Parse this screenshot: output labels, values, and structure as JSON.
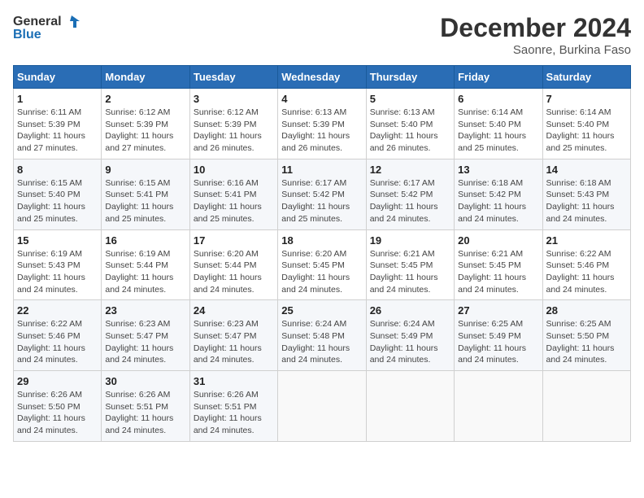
{
  "header": {
    "logo_line1": "General",
    "logo_line2": "Blue",
    "title": "December 2024",
    "subtitle": "Saonre, Burkina Faso"
  },
  "days_of_week": [
    "Sunday",
    "Monday",
    "Tuesday",
    "Wednesday",
    "Thursday",
    "Friday",
    "Saturday"
  ],
  "weeks": [
    [
      {
        "day": "1",
        "info": "Sunrise: 6:11 AM\nSunset: 5:39 PM\nDaylight: 11 hours\nand 27 minutes."
      },
      {
        "day": "2",
        "info": "Sunrise: 6:12 AM\nSunset: 5:39 PM\nDaylight: 11 hours\nand 27 minutes."
      },
      {
        "day": "3",
        "info": "Sunrise: 6:12 AM\nSunset: 5:39 PM\nDaylight: 11 hours\nand 26 minutes."
      },
      {
        "day": "4",
        "info": "Sunrise: 6:13 AM\nSunset: 5:39 PM\nDaylight: 11 hours\nand 26 minutes."
      },
      {
        "day": "5",
        "info": "Sunrise: 6:13 AM\nSunset: 5:40 PM\nDaylight: 11 hours\nand 26 minutes."
      },
      {
        "day": "6",
        "info": "Sunrise: 6:14 AM\nSunset: 5:40 PM\nDaylight: 11 hours\nand 25 minutes."
      },
      {
        "day": "7",
        "info": "Sunrise: 6:14 AM\nSunset: 5:40 PM\nDaylight: 11 hours\nand 25 minutes."
      }
    ],
    [
      {
        "day": "8",
        "info": "Sunrise: 6:15 AM\nSunset: 5:40 PM\nDaylight: 11 hours\nand 25 minutes."
      },
      {
        "day": "9",
        "info": "Sunrise: 6:15 AM\nSunset: 5:41 PM\nDaylight: 11 hours\nand 25 minutes."
      },
      {
        "day": "10",
        "info": "Sunrise: 6:16 AM\nSunset: 5:41 PM\nDaylight: 11 hours\nand 25 minutes."
      },
      {
        "day": "11",
        "info": "Sunrise: 6:17 AM\nSunset: 5:42 PM\nDaylight: 11 hours\nand 25 minutes."
      },
      {
        "day": "12",
        "info": "Sunrise: 6:17 AM\nSunset: 5:42 PM\nDaylight: 11 hours\nand 24 minutes."
      },
      {
        "day": "13",
        "info": "Sunrise: 6:18 AM\nSunset: 5:42 PM\nDaylight: 11 hours\nand 24 minutes."
      },
      {
        "day": "14",
        "info": "Sunrise: 6:18 AM\nSunset: 5:43 PM\nDaylight: 11 hours\nand 24 minutes."
      }
    ],
    [
      {
        "day": "15",
        "info": "Sunrise: 6:19 AM\nSunset: 5:43 PM\nDaylight: 11 hours\nand 24 minutes."
      },
      {
        "day": "16",
        "info": "Sunrise: 6:19 AM\nSunset: 5:44 PM\nDaylight: 11 hours\nand 24 minutes."
      },
      {
        "day": "17",
        "info": "Sunrise: 6:20 AM\nSunset: 5:44 PM\nDaylight: 11 hours\nand 24 minutes."
      },
      {
        "day": "18",
        "info": "Sunrise: 6:20 AM\nSunset: 5:45 PM\nDaylight: 11 hours\nand 24 minutes."
      },
      {
        "day": "19",
        "info": "Sunrise: 6:21 AM\nSunset: 5:45 PM\nDaylight: 11 hours\nand 24 minutes."
      },
      {
        "day": "20",
        "info": "Sunrise: 6:21 AM\nSunset: 5:45 PM\nDaylight: 11 hours\nand 24 minutes."
      },
      {
        "day": "21",
        "info": "Sunrise: 6:22 AM\nSunset: 5:46 PM\nDaylight: 11 hours\nand 24 minutes."
      }
    ],
    [
      {
        "day": "22",
        "info": "Sunrise: 6:22 AM\nSunset: 5:46 PM\nDaylight: 11 hours\nand 24 minutes."
      },
      {
        "day": "23",
        "info": "Sunrise: 6:23 AM\nSunset: 5:47 PM\nDaylight: 11 hours\nand 24 minutes."
      },
      {
        "day": "24",
        "info": "Sunrise: 6:23 AM\nSunset: 5:47 PM\nDaylight: 11 hours\nand 24 minutes."
      },
      {
        "day": "25",
        "info": "Sunrise: 6:24 AM\nSunset: 5:48 PM\nDaylight: 11 hours\nand 24 minutes."
      },
      {
        "day": "26",
        "info": "Sunrise: 6:24 AM\nSunset: 5:49 PM\nDaylight: 11 hours\nand 24 minutes."
      },
      {
        "day": "27",
        "info": "Sunrise: 6:25 AM\nSunset: 5:49 PM\nDaylight: 11 hours\nand 24 minutes."
      },
      {
        "day": "28",
        "info": "Sunrise: 6:25 AM\nSunset: 5:50 PM\nDaylight: 11 hours\nand 24 minutes."
      }
    ],
    [
      {
        "day": "29",
        "info": "Sunrise: 6:26 AM\nSunset: 5:50 PM\nDaylight: 11 hours\nand 24 minutes."
      },
      {
        "day": "30",
        "info": "Sunrise: 6:26 AM\nSunset: 5:51 PM\nDaylight: 11 hours\nand 24 minutes."
      },
      {
        "day": "31",
        "info": "Sunrise: 6:26 AM\nSunset: 5:51 PM\nDaylight: 11 hours\nand 24 minutes."
      },
      null,
      null,
      null,
      null
    ]
  ]
}
